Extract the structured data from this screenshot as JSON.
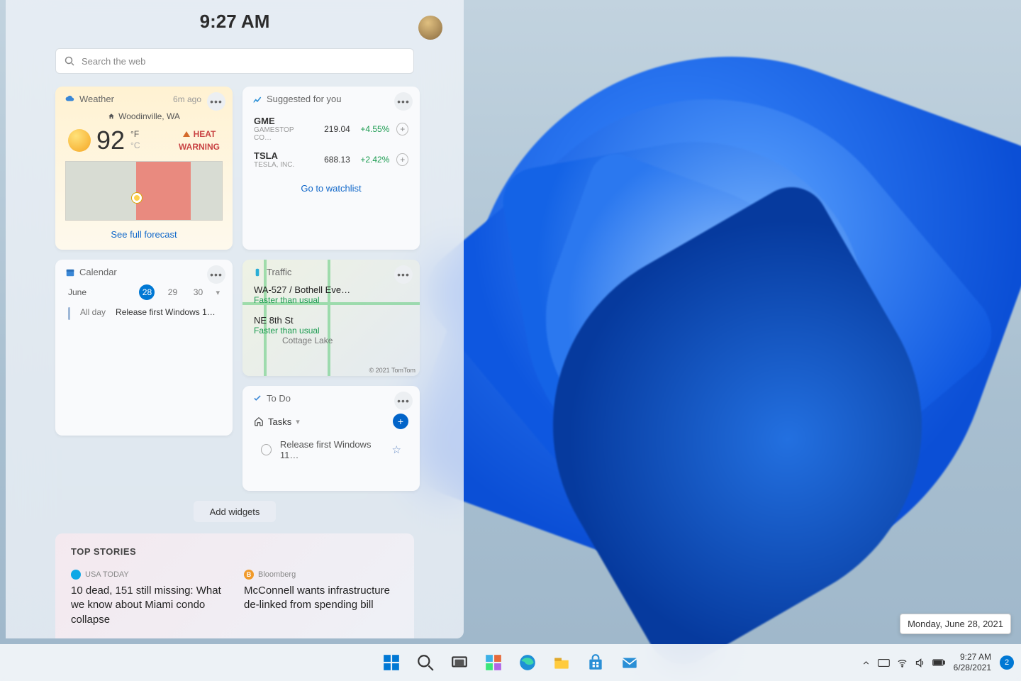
{
  "header": {
    "time": "9:27 AM"
  },
  "search": {
    "placeholder": "Search the web"
  },
  "weather": {
    "title": "Weather",
    "updated": "6m ago",
    "location": "Woodinville, WA",
    "temp": "92",
    "unit_f": "°F",
    "unit_c": "°C",
    "alert_line1": "HEAT",
    "alert_line2": "WARNING",
    "link": "See full forecast"
  },
  "calendar": {
    "title": "Calendar",
    "month": "June",
    "days": [
      "28",
      "29",
      "30"
    ],
    "allday": "All day",
    "event": "Release first Windows 1…"
  },
  "stocks": {
    "title": "Suggested for you",
    "rows": [
      {
        "ticker": "GME",
        "company": "GAMESTOP CO…",
        "price": "219.04",
        "change": "+4.55%"
      },
      {
        "ticker": "TSLA",
        "company": "TESLA, INC.",
        "price": "688.13",
        "change": "+2.42%"
      }
    ],
    "link": "Go to watchlist"
  },
  "traffic": {
    "title": "Traffic",
    "route1": "WA-527 / Bothell Eve…",
    "status1": "Faster than usual",
    "route2": "NE 8th St",
    "status2": "Faster than usual",
    "place": "Cottage Lake",
    "attribution": "© 2021 TomTom"
  },
  "todo": {
    "title": "To Do",
    "list": "Tasks",
    "item": "Release first Windows 11…"
  },
  "addWidgets": "Add widgets",
  "topStories": {
    "title": "TOP STORIES",
    "items": [
      {
        "source": "USA TODAY",
        "srcBg": "#0ea8e6",
        "srcInitial": "●",
        "headline": "10 dead, 151 still missing: What we know about Miami condo collapse"
      },
      {
        "source": "Bloomberg",
        "srcBg": "#f09a2b",
        "srcInitial": "B",
        "headline": "McConnell wants infrastructure de-linked from spending bill"
      }
    ]
  },
  "tooltip": "Monday, June 28, 2021",
  "taskbar": {
    "time": "9:27 AM",
    "date": "6/28/2021",
    "badge": "2"
  }
}
